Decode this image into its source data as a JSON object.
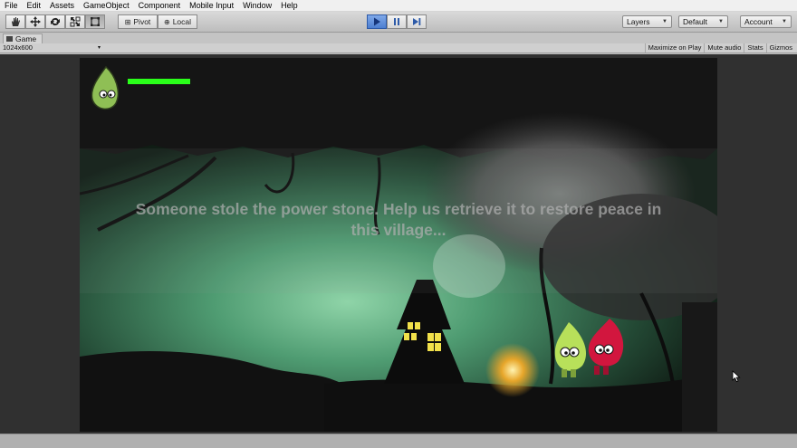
{
  "menu": [
    "File",
    "Edit",
    "Assets",
    "GameObject",
    "Component",
    "Mobile Input",
    "Window",
    "Help"
  ],
  "toolbar": {
    "pivot_label": "Pivot",
    "local_label": "Local",
    "layers_label": "Layers",
    "layout_label": "Default",
    "account_label": "Account"
  },
  "game_tab": {
    "title": "Game",
    "resolution": "1024x600"
  },
  "view_options": [
    "Maximize on Play",
    "Mute audio",
    "Stats",
    "Gizmos"
  ],
  "game": {
    "story_text": "Someone stole the power stone. Help us retrieve it to restore peace in this village...",
    "player_health": 1.0
  },
  "colors": {
    "health_bar": "#2aff1a",
    "play_accent": "#4d7fd1",
    "player_leaf": "#b8e05a",
    "companion_leaf": "#d2163e"
  }
}
